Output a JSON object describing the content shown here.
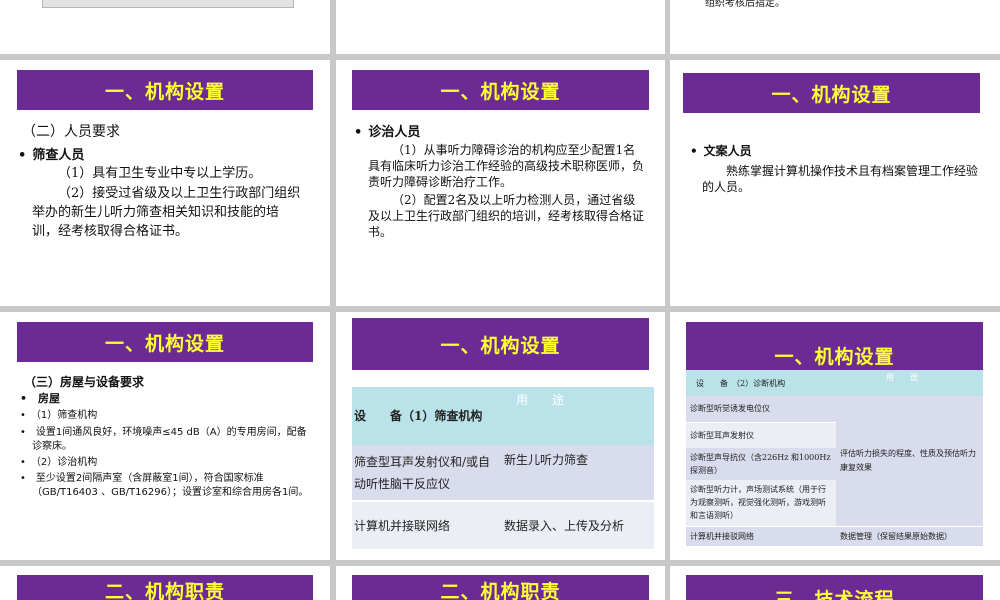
{
  "top_right_text": "组织考核后指定。",
  "slides": {
    "s4": {
      "banner": "一、机构设置",
      "heading": "（二）人员要求",
      "bullet": "筛查人员",
      "p1": "（1）具有卫生专业中专以上学历。",
      "p2": "（2）接受过省级及以上卫生行政部门组织举办的新生儿听力筛查相关知识和技能的培训，经考核取得合格证书。"
    },
    "s5": {
      "banner": "一、机构设置",
      "bullet": "诊治人员",
      "p1": "（1）从事听力障碍诊治的机构应至少配置1名具有临床听力诊治工作经验的高级技术职称医师，负责听力障碍诊断治疗工作。",
      "p2": "（2）配置2名及以上听力检测人员，通过省级及以上卫生行政部门组织的培训，经考核取得合格证书。"
    },
    "s6": {
      "banner": "一、机构设置",
      "bullet": "文案人员",
      "p1": "熟练掌握计算机操作技术且有档案管理工作经验的人员。"
    },
    "s7": {
      "banner": "一、机构设置",
      "heading": "（三）房屋与设备要求",
      "items": [
        "房屋",
        "（1）筛查机构",
        "设置1间通风良好，环境噪声≤45 dB（A）的专用房间，配备诊察床。",
        "（2）诊治机构",
        "至少设置2间隔声室（含屏蔽室1间），符合国家标准（GB/T16403 、GB/T16296）；设置诊室和综合用房各1间。"
      ]
    },
    "s8": {
      "banner": "一、机构设置",
      "header": [
        "设　　备（1）筛查机构",
        "用　　途"
      ],
      "rows": [
        [
          "筛查型耳声发射仪和/或自动听性脑干反应仪",
          "新生儿听力筛查"
        ],
        [
          "计算机并接联网络",
          "数据录入、上传及分析"
        ]
      ]
    },
    "s9": {
      "banner": "一、机构设置",
      "header": [
        "设　　备　（2）诊断机构",
        "用　　途"
      ],
      "rows": [
        "诊断型听觉诱发电位仪",
        "诊断型耳声发射仪",
        "诊断型声导抗仪（含226Hz 和1000Hz探测音）",
        "诊断型听力计，声场测试系统（用于行为观察测听，视觉强化测听，游戏测听和言语测听）"
      ],
      "merged_use": "评估听力损失的程度、性质及预估听力康复效果",
      "last_row": [
        "计算机并接驳网络",
        "数据管理（保留结果原始数据）"
      ]
    },
    "s10": {
      "banner": "二、机构职责"
    },
    "s11": {
      "banner": "二、机构职责"
    },
    "s12": {
      "banner": "三、技术流程"
    }
  }
}
